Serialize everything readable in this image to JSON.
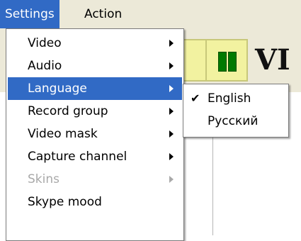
{
  "menubar": {
    "items": [
      {
        "label": "Settings"
      },
      {
        "label": "Action"
      }
    ]
  },
  "toolbar": {
    "text_label": "VI"
  },
  "settings_menu": {
    "items": [
      {
        "label": "Video",
        "submenu": true
      },
      {
        "label": "Audio",
        "submenu": true
      },
      {
        "label": "Language",
        "submenu": true,
        "selected": true
      },
      {
        "label": "Record group",
        "submenu": true
      },
      {
        "label": "Video mask",
        "submenu": true
      },
      {
        "label": "Capture channel",
        "submenu": true
      },
      {
        "label": "Skins",
        "submenu": true,
        "disabled": true
      },
      {
        "label": "Skype mood",
        "submenu": false
      }
    ]
  },
  "language_submenu": {
    "items": [
      {
        "label": "English",
        "checked": true,
        "check_mark": "✔"
      },
      {
        "label": "Русский",
        "checked": false
      }
    ]
  },
  "colors": {
    "highlight": "#316ac5",
    "menubar_bg": "#ece9d8",
    "disabled_text": "#a9a9a9",
    "pause_button": "#007a00"
  }
}
